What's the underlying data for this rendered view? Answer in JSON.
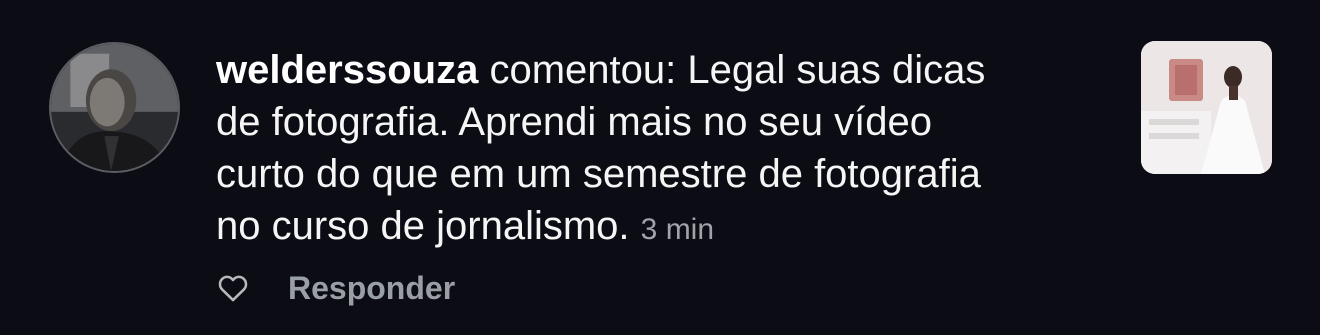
{
  "notification": {
    "username": "welderssouza",
    "verb": "comentou:",
    "comment_lines": [
      "Legal suas dicas",
      "de fotografia. Aprendi mais no seu vídeo",
      "curto do que em um semestre de fotografia",
      "no curso de jornalismo."
    ],
    "timestamp": "3 min",
    "avatar_icon": "user-avatar-photo",
    "thumbnail_icon": "post-thumbnail-photo"
  },
  "actions": {
    "like_icon": "heart-outline-icon",
    "reply_label": "Responder"
  },
  "colors": {
    "background": "#0c0d14",
    "text": "#f5f5f5",
    "secondary_text": "#9a9ea5"
  }
}
